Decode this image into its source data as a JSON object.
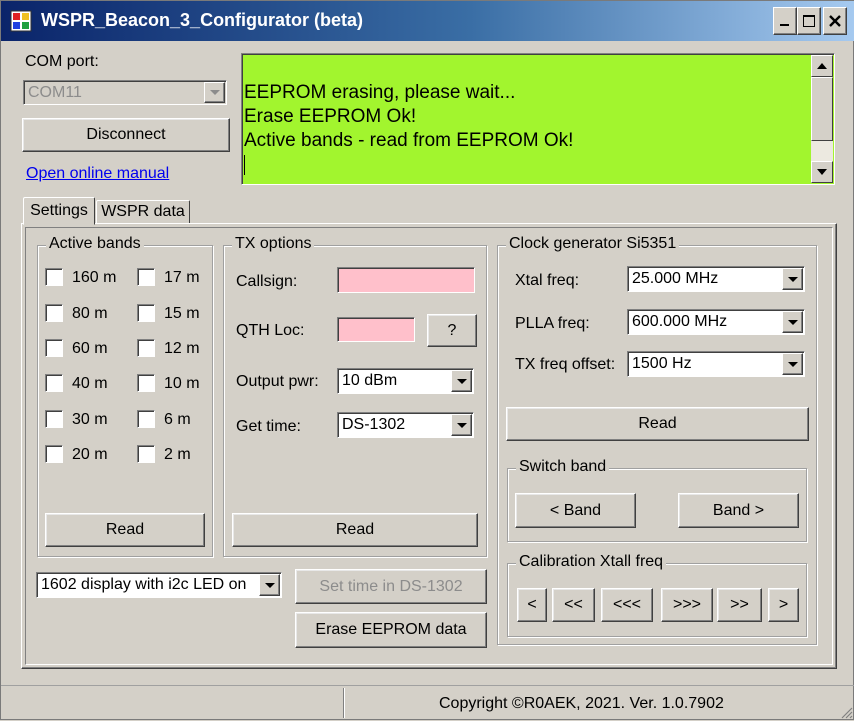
{
  "window": {
    "title": "WSPR_Beacon_3_Configurator (beta)",
    "minimize_icon": "minimize-icon",
    "maximize_icon": "maximize-icon",
    "close_icon": "close-icon"
  },
  "com": {
    "label": "COM port:",
    "value": "COM11",
    "disconnect_label": "Disconnect",
    "manual_link": "Open online manual"
  },
  "log": {
    "lines": [
      "EEPROM erasing, please wait...",
      "Erase EEPROM Ok!",
      "Active bands - read from EEPROM Ok!"
    ],
    "background": "#a2f52e"
  },
  "tabs": [
    {
      "label": "Settings",
      "active": true
    },
    {
      "label": "WSPR data",
      "active": false
    }
  ],
  "active_bands": {
    "title": "Active bands",
    "bands": [
      {
        "label": "160 m",
        "checked": false
      },
      {
        "label": "17 m",
        "checked": false
      },
      {
        "label": "80 m",
        "checked": false
      },
      {
        "label": "15 m",
        "checked": false
      },
      {
        "label": "60 m",
        "checked": false
      },
      {
        "label": "12 m",
        "checked": false
      },
      {
        "label": "40 m",
        "checked": false
      },
      {
        "label": "10 m",
        "checked": false
      },
      {
        "label": "30 m",
        "checked": false
      },
      {
        "label": "6 m",
        "checked": false
      },
      {
        "label": "20 m",
        "checked": false
      },
      {
        "label": "2 m",
        "checked": false
      }
    ],
    "read_label": "Read"
  },
  "tx_options": {
    "title": "TX options",
    "callsign_label": "Callsign:",
    "callsign_value": "",
    "qth_label": "QTH Loc:",
    "qth_value": "",
    "qth_help_label": "?",
    "output_pwr_label": "Output pwr:",
    "output_pwr_value": "10 dBm",
    "get_time_label": "Get time:",
    "get_time_value": "DS-1302",
    "read_label": "Read",
    "input_color": "#ffc0cb"
  },
  "clock": {
    "title": "Clock generator Si5351",
    "xtal_label": "Xtal freq:",
    "xtal_value": "25.000 MHz",
    "plla_label": "PLLA freq:",
    "plla_value": "600.000 MHz",
    "tx_offset_label": "TX freq offset:",
    "tx_offset_value": "1500 Hz",
    "read_label": "Read"
  },
  "switch_band": {
    "title": "Switch band",
    "prev_label": "< Band",
    "next_label": "Band >"
  },
  "calibration": {
    "title": "Calibration Xtall freq",
    "buttons": [
      "<",
      "<<",
      "<<<",
      ">>>",
      ">>",
      ">"
    ]
  },
  "display": {
    "value": "1602 display with i2c LED on"
  },
  "actions": {
    "set_time_label": "Set time in DS-1302",
    "erase_label": "Erase EEPROM data"
  },
  "status": {
    "copyright": "Copyright ©R0AEK, 2021. Ver. 1.0.7902"
  }
}
